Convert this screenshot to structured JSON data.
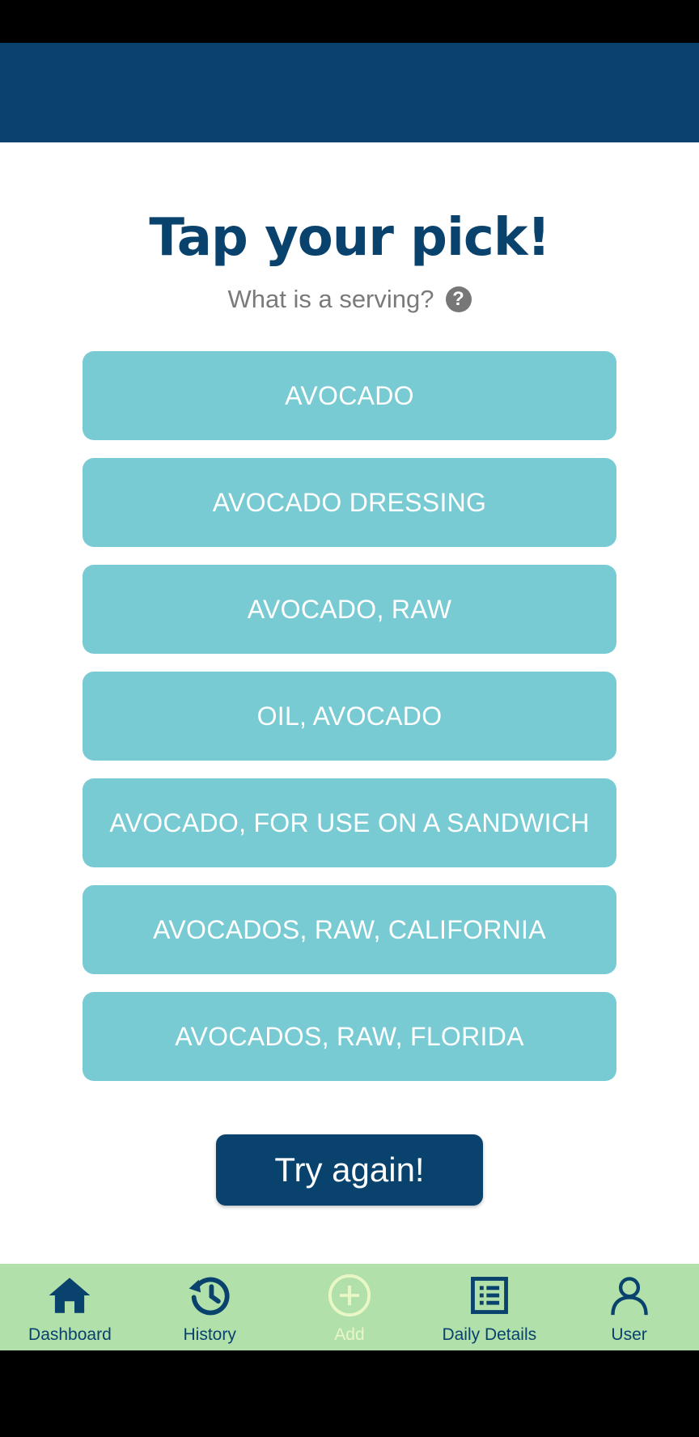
{
  "screen": {
    "title": "Tap your pick!",
    "serving_question": "What is a serving?",
    "help_icon_glyph": "?"
  },
  "options": [
    {
      "label": "AVOCADO"
    },
    {
      "label": "AVOCADO DRESSING"
    },
    {
      "label": "AVOCADO, RAW"
    },
    {
      "label": "OIL, AVOCADO"
    },
    {
      "label": "AVOCADO, FOR USE ON A SANDWICH"
    },
    {
      "label": "AVOCADOS, RAW, CALIFORNIA"
    },
    {
      "label": "AVOCADOS, RAW, FLORIDA"
    }
  ],
  "try_again_label": "Try again!",
  "nav": {
    "items": [
      {
        "label": "Dashboard",
        "icon": "home-icon"
      },
      {
        "label": "History",
        "icon": "history-icon"
      },
      {
        "label": "Add",
        "icon": "add-circle-icon"
      },
      {
        "label": "Daily Details",
        "icon": "list-icon"
      },
      {
        "label": "User",
        "icon": "user-icon"
      }
    ]
  },
  "colors": {
    "header": "#08426d",
    "option_bg": "#78cad3",
    "nav_bg": "#b1e0ab",
    "nav_active": "#e9f7c6"
  }
}
